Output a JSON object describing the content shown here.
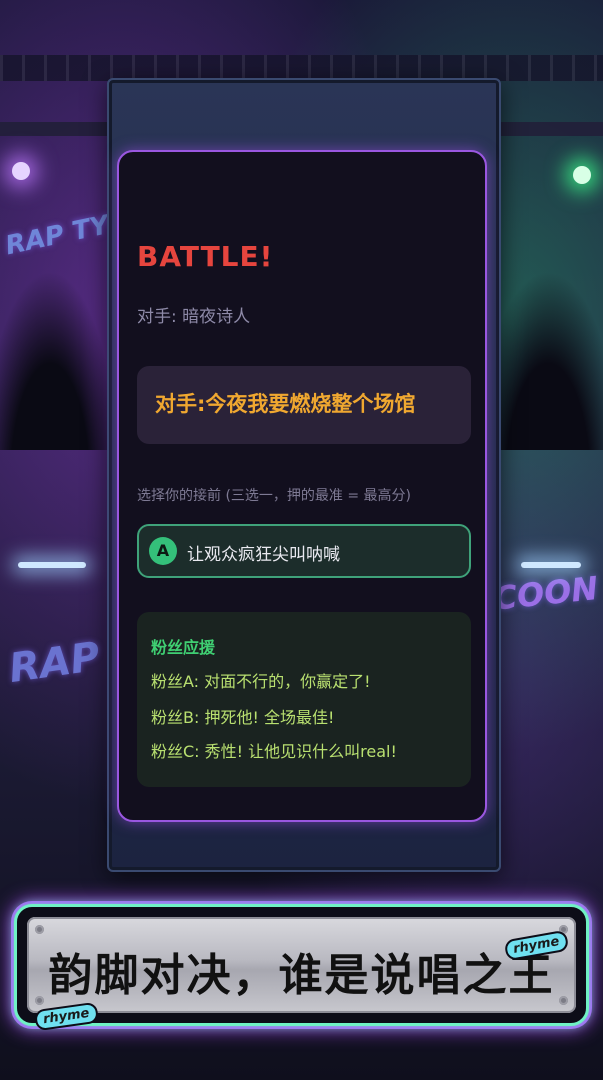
{
  "background": {
    "graffiti_left_top": "RAP TYCOON",
    "graffiti_left_bottom": "RAP TYCOON",
    "graffiti_right": "RAP TYCOON"
  },
  "card": {
    "title": "BATTLE!",
    "opponent": "对手: 暗夜诗人",
    "opponent_line": "对手:今夜我要燃烧整个场馆",
    "prompt": "选择你的接前 (三选一，押的最准 = 最高分)",
    "options": [
      {
        "key": "A",
        "text": "让观众疯狂尖叫呐喊"
      }
    ],
    "fans": {
      "title": "粉丝应援",
      "messages": [
        "粉丝A: 对面不行的，你赢定了!",
        "粉丝B: 押死他! 全场最佳!",
        "粉丝C: 秀性! 让他见识什么叫real!"
      ]
    }
  },
  "banner": {
    "slogan": "韵脚对决，谁是说唱之王",
    "tag": "rhyme"
  },
  "colors": {
    "title_red": "#e6453e",
    "lyric_orange": "#f0a830",
    "option_green": "#34c07a",
    "fans_green": "#3fcf72",
    "card_border_purple": "#9a57e0",
    "banner_glow_cyan": "#6ff2c4"
  }
}
